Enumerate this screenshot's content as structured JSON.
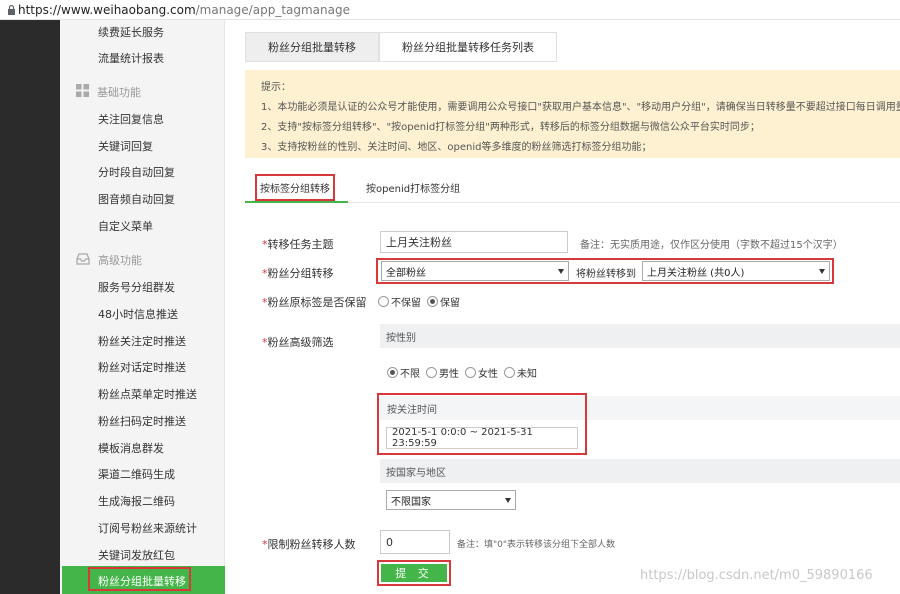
{
  "browser": {
    "url_host": "https://www.weihaobang.com",
    "url_path": "/manage/app_tagmanage"
  },
  "sidebar": {
    "items_top": [
      "续费延长服务",
      "流量统计报表"
    ],
    "section_basic": "基础功能",
    "items_basic": [
      "关注回复信息",
      "关键词回复",
      "分时段自动回复",
      "图音频自动回复",
      "自定义菜单"
    ],
    "section_advanced": "高级功能",
    "items_advanced": [
      "服务号分组群发",
      "48小时信息推送",
      "粉丝关注定时推送",
      "粉丝对话定时推送",
      "粉丝点菜单定时推送",
      "粉丝扫码定时推送",
      "模板消息群发",
      "渠道二维码生成",
      "生成海报二维码",
      "订阅号粉丝来源统计",
      "关键词发放红包"
    ],
    "active_item": "粉丝分组批量转移"
  },
  "top_tabs": [
    "粉丝分组批量转移",
    "粉丝分组批量转移任务列表"
  ],
  "notice": {
    "title": "提示：",
    "lines": [
      "1、本功能必须是认证的公众号才能使用，需要调用公众号接口\"获取用户基本信息\"、\"移动用户分组\"，请确保当日转移量不要超过接口每日调用量的上限；",
      "2、支持\"按标签分组转移\"、\"按openid打标签分组\"两种形式，转移后的标签分组数据与微信公众平台实时同步；",
      "3、支持按粉丝的性别、关注时间、地区、openid等多维度的粉丝筛选打标签分组功能；"
    ]
  },
  "sub_tabs": [
    "按标签分组转移",
    "按openid打标签分组"
  ],
  "form": {
    "task_subject": {
      "label": "转移任务主题",
      "value": "上月关注粉丝",
      "note": "备注：无实质用途，仅作区分使用（字数不超过15个汉字）"
    },
    "group_transfer": {
      "label": "粉丝分组转移",
      "from_value": "全部粉丝",
      "middle_text": "将粉丝转移到",
      "to_value": "上月关注粉丝  (共0人)"
    },
    "keep_original": {
      "label": "粉丝原标签是否保留",
      "options": [
        "不保留",
        "保留"
      ],
      "selected": "保留"
    },
    "advanced_filter": {
      "label": "粉丝高级筛选",
      "gender_title": "按性别",
      "gender_options": [
        "不限",
        "男性",
        "女性",
        "未知"
      ],
      "gender_selected": "不限",
      "time_title": "按关注时间",
      "time_value": "2021-5-1 0:0:0 ~ 2021-5-31 23:59:59",
      "region_title": "按国家与地区",
      "region_value": "不限国家"
    },
    "limit_count": {
      "label": "限制粉丝转移人数",
      "value": "0",
      "note": "备注：填\"0\"表示转移该分组下全部人数"
    },
    "submit_label": "提 交",
    "required_mark": "*"
  },
  "watermark": "https://blog.csdn.net/m0_59890166",
  "colors": {
    "accent": "#44b549",
    "highlight": "#d9383a",
    "notice_bg": "#fdf1d2"
  }
}
